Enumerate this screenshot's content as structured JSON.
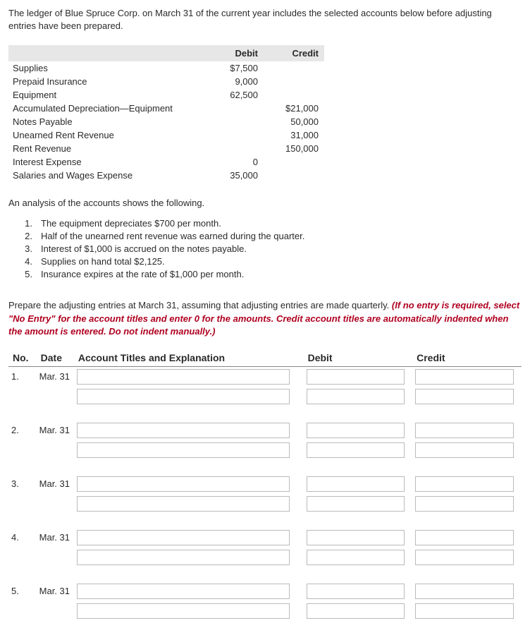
{
  "intro": "The ledger of Blue Spruce Corp. on March 31 of the current year includes the selected accounts below before adjusting entries have been prepared.",
  "ledger": {
    "headers": {
      "debit": "Debit",
      "credit": "Credit"
    },
    "rows": [
      {
        "account": "Supplies",
        "debit": "$7,500",
        "credit": ""
      },
      {
        "account": "Prepaid Insurance",
        "debit": "9,000",
        "credit": ""
      },
      {
        "account": "Equipment",
        "debit": "62,500",
        "credit": ""
      },
      {
        "account": "Accumulated Depreciation—Equipment",
        "debit": "",
        "credit": "$21,000"
      },
      {
        "account": "Notes Payable",
        "debit": "",
        "credit": "50,000"
      },
      {
        "account": "Unearned Rent Revenue",
        "debit": "",
        "credit": "31,000"
      },
      {
        "account": "Rent Revenue",
        "debit": "",
        "credit": "150,000"
      },
      {
        "account": "Interest Expense",
        "debit": "0",
        "credit": ""
      },
      {
        "account": "Salaries and Wages Expense",
        "debit": "35,000",
        "credit": ""
      }
    ]
  },
  "analysis_intro": "An analysis of the accounts shows the following.",
  "analysis": [
    "The equipment depreciates $700 per month.",
    "Half of the unearned rent revenue was earned during the quarter.",
    "Interest of $1,000 is accrued on the notes payable.",
    "Supplies on hand total $2,125.",
    "Insurance expires at the rate of $1,000 per month."
  ],
  "prepare_text": "Prepare the adjusting entries at March 31, assuming that adjusting entries are made quarterly. ",
  "prepare_hint": "(If no entry is required, select \"No Entry\" for the account titles and enter 0 for the amounts. Credit account titles are automatically indented when the amount is entered. Do not indent manually.)",
  "entry_headers": {
    "no": "No.",
    "date": "Date",
    "acct": "Account Titles and Explanation",
    "debit": "Debit",
    "credit": "Credit"
  },
  "entry_rows": [
    {
      "no": "1.",
      "date": "Mar. 31"
    },
    {
      "no": "2.",
      "date": "Mar. 31"
    },
    {
      "no": "3.",
      "date": "Mar. 31"
    },
    {
      "no": "4.",
      "date": "Mar. 31"
    },
    {
      "no": "5.",
      "date": "Mar. 31"
    }
  ]
}
